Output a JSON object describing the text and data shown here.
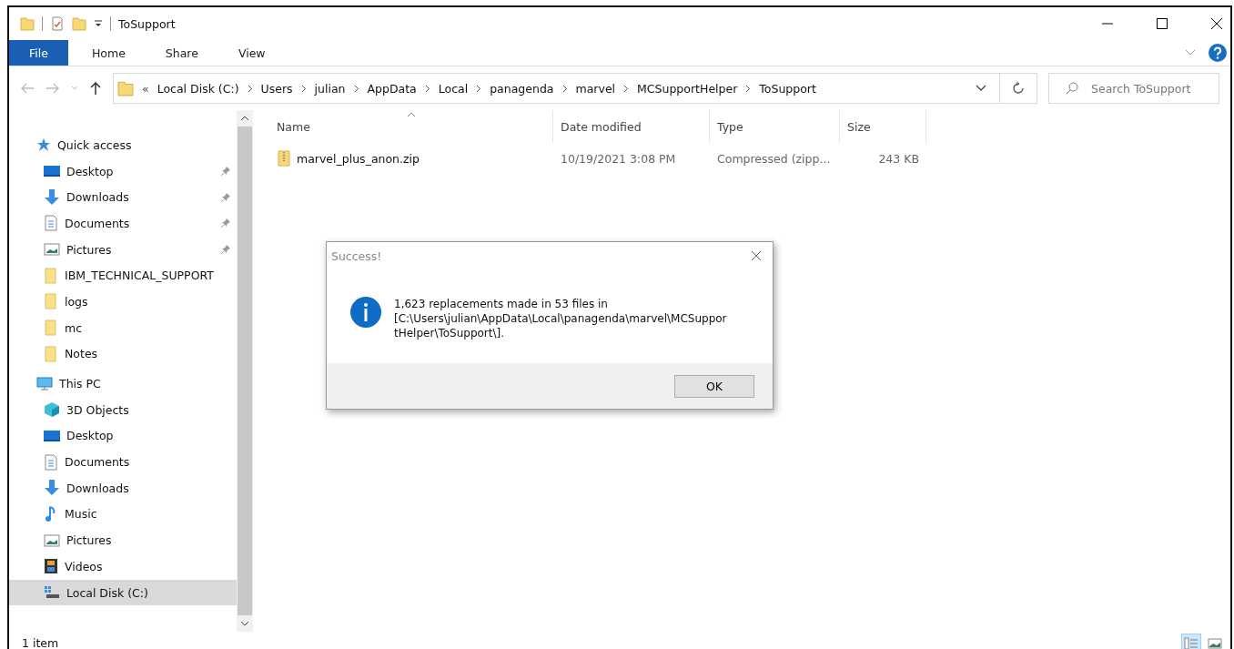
{
  "window": {
    "title": "ToSupport"
  },
  "ribbon_tabs": [
    {
      "label": "File",
      "selected": true
    },
    {
      "label": "Home",
      "selected": false
    },
    {
      "label": "Share",
      "selected": false
    },
    {
      "label": "View",
      "selected": false
    }
  ],
  "address_bar": {
    "overflow": "«",
    "path": [
      "Local Disk (C:)",
      "Users",
      "julian",
      "AppData",
      "Local",
      "panagenda",
      "marvel",
      "MCSupportHelper",
      "ToSupport"
    ]
  },
  "search": {
    "placeholder": "Search ToSupport"
  },
  "sidebar": {
    "items": [
      {
        "label": "Quick access",
        "kind": "quick",
        "selected": false,
        "children": [
          {
            "label": "Desktop",
            "kind": "desktop",
            "pinned": true,
            "selected": false
          },
          {
            "label": "Downloads",
            "kind": "downloads",
            "pinned": true,
            "selected": false
          },
          {
            "label": "Documents",
            "kind": "documents",
            "pinned": true,
            "selected": false
          },
          {
            "label": "Pictures",
            "kind": "pictures",
            "pinned": true,
            "selected": false
          },
          {
            "label": "IBM_TECHNICAL_SUPPORT",
            "kind": "folder",
            "pinned": false,
            "selected": false
          },
          {
            "label": "logs",
            "kind": "folder",
            "pinned": false,
            "selected": false
          },
          {
            "label": "mc",
            "kind": "folder",
            "pinned": false,
            "selected": false
          },
          {
            "label": "Notes",
            "kind": "folder",
            "pinned": false,
            "selected": false
          }
        ]
      },
      {
        "label": "This PC",
        "kind": "pc",
        "selected": false,
        "children": [
          {
            "label": "3D Objects",
            "kind": "objects",
            "pinned": false,
            "selected": false
          },
          {
            "label": "Desktop",
            "kind": "desktop",
            "pinned": false,
            "selected": false
          },
          {
            "label": "Documents",
            "kind": "documents",
            "pinned": false,
            "selected": false
          },
          {
            "label": "Downloads",
            "kind": "downloads",
            "pinned": false,
            "selected": false
          },
          {
            "label": "Music",
            "kind": "music",
            "pinned": false,
            "selected": false
          },
          {
            "label": "Pictures",
            "kind": "pictures",
            "pinned": false,
            "selected": false
          },
          {
            "label": "Videos",
            "kind": "videos",
            "pinned": false,
            "selected": false
          },
          {
            "label": "Local Disk (C:)",
            "kind": "disk",
            "pinned": false,
            "selected": true
          }
        ]
      }
    ]
  },
  "table": {
    "columns": [
      {
        "label": "Name",
        "sorted": true
      },
      {
        "label": "Date modified",
        "sorted": false
      },
      {
        "label": "Type",
        "sorted": false
      },
      {
        "label": "Size",
        "sorted": false
      }
    ],
    "rows": [
      {
        "name": "marvel_plus_anon.zip",
        "date": "10/19/2021 3:08 PM",
        "type": "Compressed (zipp...",
        "size": "243 KB"
      }
    ]
  },
  "status_bar": {
    "text": "1 item",
    "views": [
      {
        "kind": "details",
        "selected": true
      },
      {
        "kind": "large",
        "selected": false
      }
    ]
  },
  "dialog": {
    "title": "Success!",
    "message": [
      "1,623 replacements made in 53 files in",
      "[C:\\Users\\julian\\AppData\\Local\\panagenda\\marvel\\MCSuppor",
      "tHelper\\ToSupport\\]."
    ],
    "button": "OK"
  }
}
